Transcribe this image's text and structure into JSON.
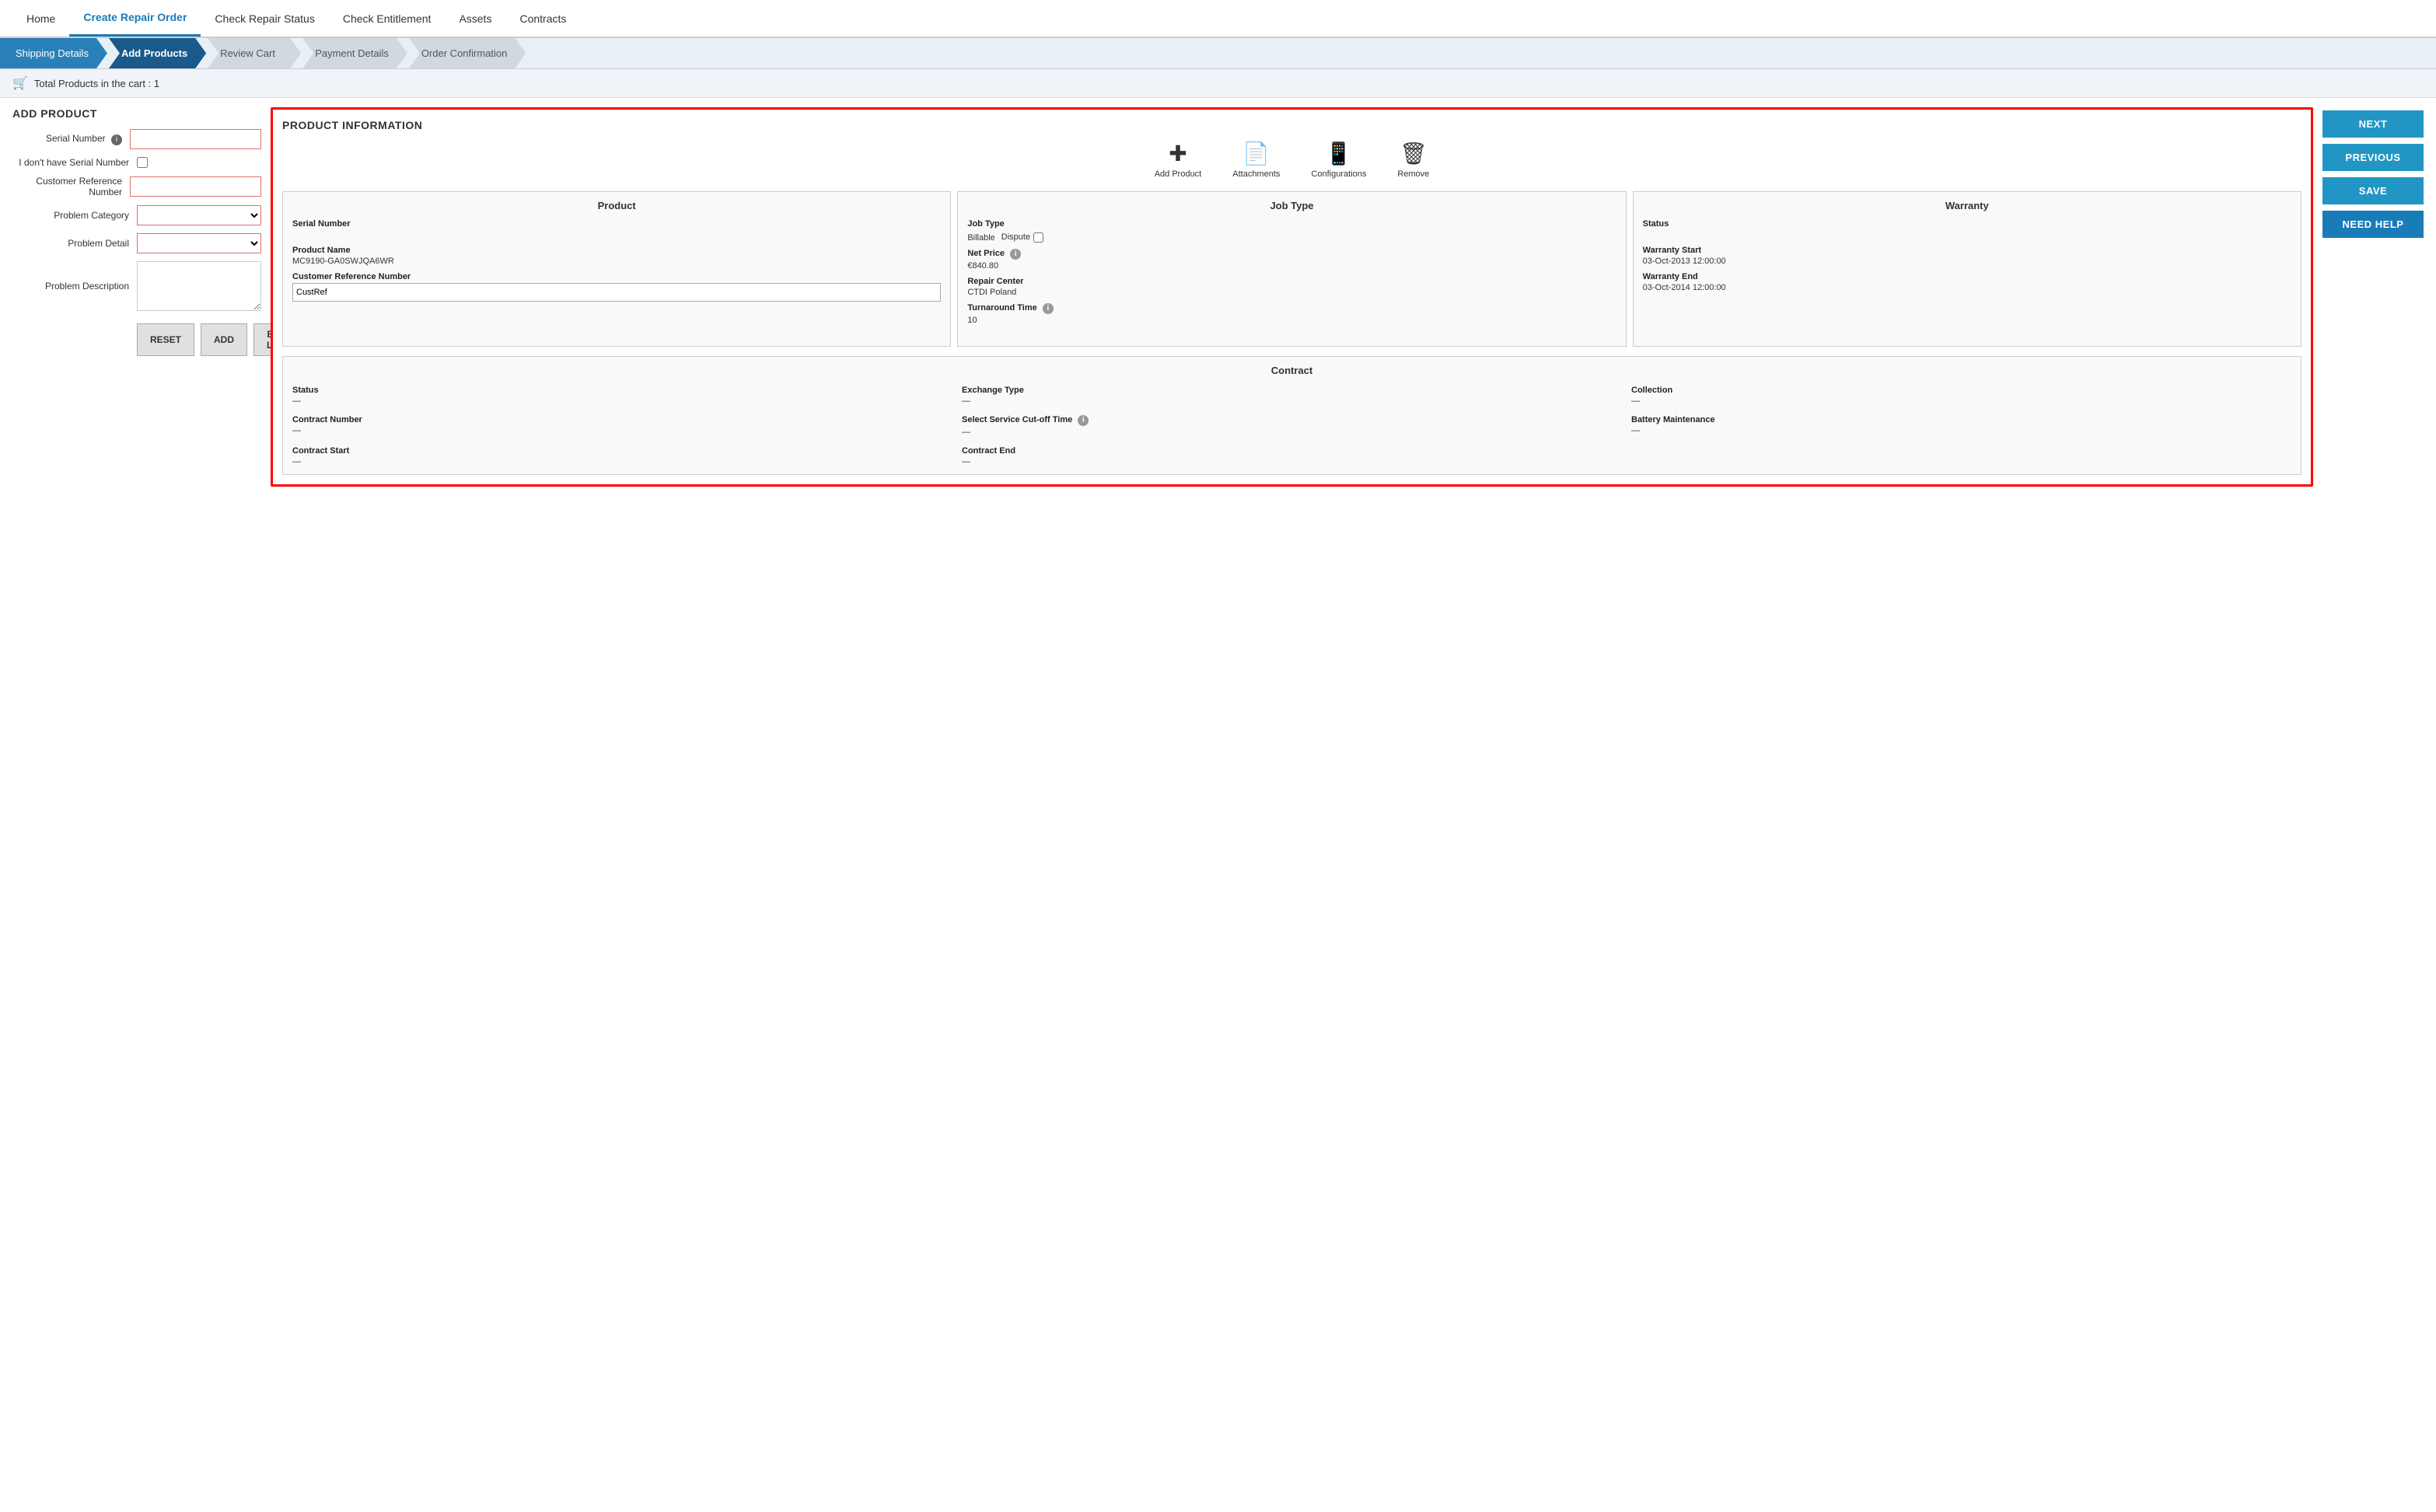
{
  "nav": {
    "items": [
      {
        "label": "Home",
        "active": false
      },
      {
        "label": "Create Repair Order",
        "active": true
      },
      {
        "label": "Check Repair Status",
        "active": false
      },
      {
        "label": "Check Entitlement",
        "active": false
      },
      {
        "label": "Assets",
        "active": false
      },
      {
        "label": "Contracts",
        "active": false
      }
    ]
  },
  "steps": [
    {
      "label": "Shipping Details",
      "state": "completed"
    },
    {
      "label": "Add Products",
      "state": "active"
    },
    {
      "label": "Review Cart",
      "state": "inactive"
    },
    {
      "label": "Payment Details",
      "state": "inactive"
    },
    {
      "label": "Order Confirmation",
      "state": "inactive"
    }
  ],
  "cart": {
    "text": "Total Products in the cart : 1"
  },
  "addProduct": {
    "title": "ADD PRODUCT",
    "serialNumberLabel": "Serial Number",
    "noSerialLabel": "I don't have Serial Number",
    "customerRefLabel": "Customer Reference Number",
    "problemCategoryLabel": "Problem Category",
    "problemDetailLabel": "Problem Detail",
    "problemDescLabel": "Problem Description",
    "resetLabel": "RESET",
    "addLabel": "ADD",
    "bulkLoadLabel": "BULK LOAD"
  },
  "productInfo": {
    "title": "PRODUCT INFORMATION",
    "actions": [
      {
        "label": "Add Product",
        "icon": "plus"
      },
      {
        "label": "Attachments",
        "icon": "doc"
      },
      {
        "label": "Configurations",
        "icon": "config"
      },
      {
        "label": "Remove",
        "icon": "trash"
      }
    ],
    "product": {
      "title": "Product",
      "serialNumberLabel": "Serial Number",
      "serialNumberValue": "",
      "productNameLabel": "Product Name",
      "productNameValue": "MC9190-GA0SWJQA6WR",
      "customerRefLabel": "Customer Reference Number",
      "customerRefValue": "CustRef"
    },
    "jobType": {
      "title": "Job Type",
      "jobTypeLabel": "Job Type",
      "jobTypeValue": "Billable",
      "disputeLabel": "Dispute",
      "netPriceLabel": "Net Price",
      "netPriceValue": "€840.80",
      "repairCenterLabel": "Repair Center",
      "repairCenterValue": "CTDI Poland",
      "turnaroundLabel": "Turnaround Time",
      "turnaroundValue": "10"
    },
    "warranty": {
      "title": "Warranty",
      "statusLabel": "Status",
      "statusValue": "",
      "warrantyStartLabel": "Warranty Start",
      "warrantyStartValue": "03-Oct-2013 12:00:00",
      "warrantyEndLabel": "Warranty End",
      "warrantyEndValue": "03-Oct-2014 12:00:00"
    },
    "contract": {
      "title": "Contract",
      "statusLabel": "Status",
      "statusValue": "—",
      "exchangeTypeLabel": "Exchange Type",
      "exchangeTypeValue": "—",
      "collectionLabel": "Collection",
      "collectionValue": "—",
      "contractNumberLabel": "Contract Number",
      "contractNumberValue": "—",
      "serviceCutoffLabel": "Select Service Cut-off Time",
      "serviceCutoffValue": "—",
      "batteryMaintenanceLabel": "Battery Maintenance",
      "batteryMaintenanceValue": "—",
      "contractStartLabel": "Contract Start",
      "contractStartValue": "—",
      "contractEndLabel": "Contract End",
      "contractEndValue": "—"
    }
  },
  "buttons": {
    "next": "NEXT",
    "previous": "PREVIOUS",
    "save": "SAVE",
    "needHelp": "NEED HELP"
  }
}
